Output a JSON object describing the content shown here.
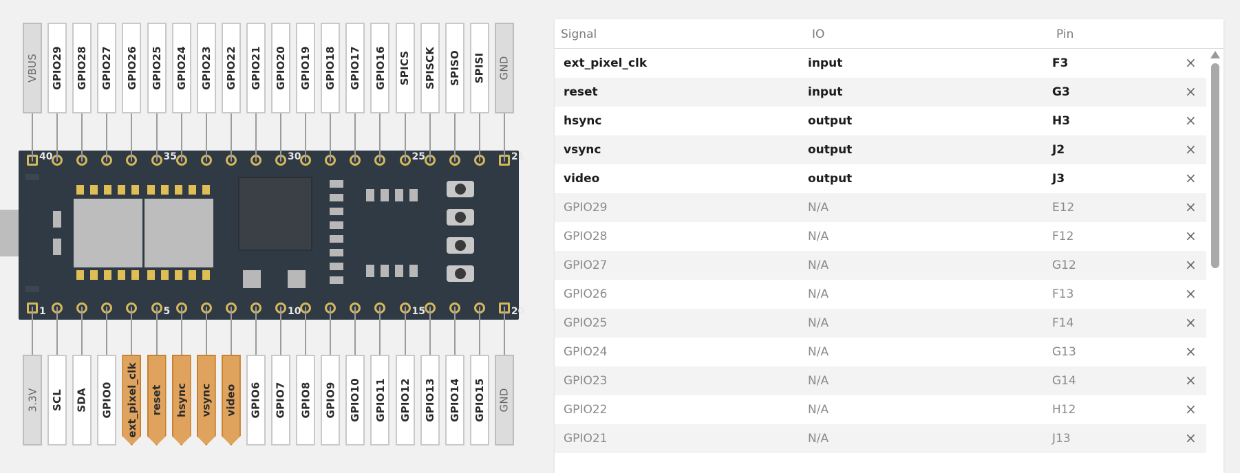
{
  "pins_top": [
    {
      "label": "VBUS",
      "kind": "power"
    },
    {
      "label": "GPIO29",
      "kind": "gpio"
    },
    {
      "label": "GPIO28",
      "kind": "gpio"
    },
    {
      "label": "GPIO27",
      "kind": "gpio"
    },
    {
      "label": "GPIO26",
      "kind": "gpio"
    },
    {
      "label": "GPIO25",
      "kind": "gpio"
    },
    {
      "label": "GPIO24",
      "kind": "gpio"
    },
    {
      "label": "GPIO23",
      "kind": "gpio"
    },
    {
      "label": "GPIO22",
      "kind": "gpio"
    },
    {
      "label": "GPIO21",
      "kind": "gpio"
    },
    {
      "label": "GPIO20",
      "kind": "gpio"
    },
    {
      "label": "GPIO19",
      "kind": "gpio"
    },
    {
      "label": "GPIO18",
      "kind": "gpio"
    },
    {
      "label": "GPIO17",
      "kind": "gpio"
    },
    {
      "label": "GPIO16",
      "kind": "gpio"
    },
    {
      "label": "SPICS",
      "kind": "gpio"
    },
    {
      "label": "SPISCK",
      "kind": "gpio"
    },
    {
      "label": "SPISO",
      "kind": "gpio"
    },
    {
      "label": "SPISI",
      "kind": "gpio"
    },
    {
      "label": "GND",
      "kind": "power"
    }
  ],
  "pins_bottom": [
    {
      "label": "3.3V",
      "kind": "power"
    },
    {
      "label": "SCL",
      "kind": "gpio"
    },
    {
      "label": "SDA",
      "kind": "gpio"
    },
    {
      "label": "GPIO0",
      "kind": "gpio"
    },
    {
      "label": "ext_pixel_clk",
      "kind": "input"
    },
    {
      "label": "reset",
      "kind": "input"
    },
    {
      "label": "hsync",
      "kind": "output"
    },
    {
      "label": "vsync",
      "kind": "output"
    },
    {
      "label": "video",
      "kind": "output"
    },
    {
      "label": "GPIO6",
      "kind": "gpio"
    },
    {
      "label": "GPIO7",
      "kind": "gpio"
    },
    {
      "label": "GPIO8",
      "kind": "gpio"
    },
    {
      "label": "GPIO9",
      "kind": "gpio"
    },
    {
      "label": "GPIO10",
      "kind": "gpio"
    },
    {
      "label": "GPIO11",
      "kind": "gpio"
    },
    {
      "label": "GPIO12",
      "kind": "gpio"
    },
    {
      "label": "GPIO13",
      "kind": "gpio"
    },
    {
      "label": "GPIO14",
      "kind": "gpio"
    },
    {
      "label": "GPIO15",
      "kind": "gpio"
    },
    {
      "label": "GND",
      "kind": "power"
    }
  ],
  "board": {
    "pin_numbers_top": [
      "40",
      "35",
      "30",
      "25",
      "21"
    ],
    "pin_numbers_bottom": [
      "1",
      "5",
      "10",
      "15",
      "20"
    ]
  },
  "colors": {
    "board": "#2f3a44",
    "pad": "#d4b85c",
    "assigned_pin": "#dfa35e"
  },
  "table": {
    "headers": {
      "signal": "Signal",
      "io": "IO",
      "pin": "Pin"
    },
    "remove_icon": "×",
    "rows": [
      {
        "signal": "ext_pixel_clk",
        "io": "input",
        "pin": "F3",
        "assigned": true
      },
      {
        "signal": "reset",
        "io": "input",
        "pin": "G3",
        "assigned": true
      },
      {
        "signal": "hsync",
        "io": "output",
        "pin": "H3",
        "assigned": true
      },
      {
        "signal": "vsync",
        "io": "output",
        "pin": "J2",
        "assigned": true
      },
      {
        "signal": "video",
        "io": "output",
        "pin": "J3",
        "assigned": true
      },
      {
        "signal": "GPIO29",
        "io": "N/A",
        "pin": "E12",
        "assigned": false
      },
      {
        "signal": "GPIO28",
        "io": "N/A",
        "pin": "F12",
        "assigned": false
      },
      {
        "signal": "GPIO27",
        "io": "N/A",
        "pin": "G12",
        "assigned": false
      },
      {
        "signal": "GPIO26",
        "io": "N/A",
        "pin": "F13",
        "assigned": false
      },
      {
        "signal": "GPIO25",
        "io": "N/A",
        "pin": "F14",
        "assigned": false
      },
      {
        "signal": "GPIO24",
        "io": "N/A",
        "pin": "G13",
        "assigned": false
      },
      {
        "signal": "GPIO23",
        "io": "N/A",
        "pin": "G14",
        "assigned": false
      },
      {
        "signal": "GPIO22",
        "io": "N/A",
        "pin": "H12",
        "assigned": false
      },
      {
        "signal": "GPIO21",
        "io": "N/A",
        "pin": "J13",
        "assigned": false
      }
    ]
  }
}
